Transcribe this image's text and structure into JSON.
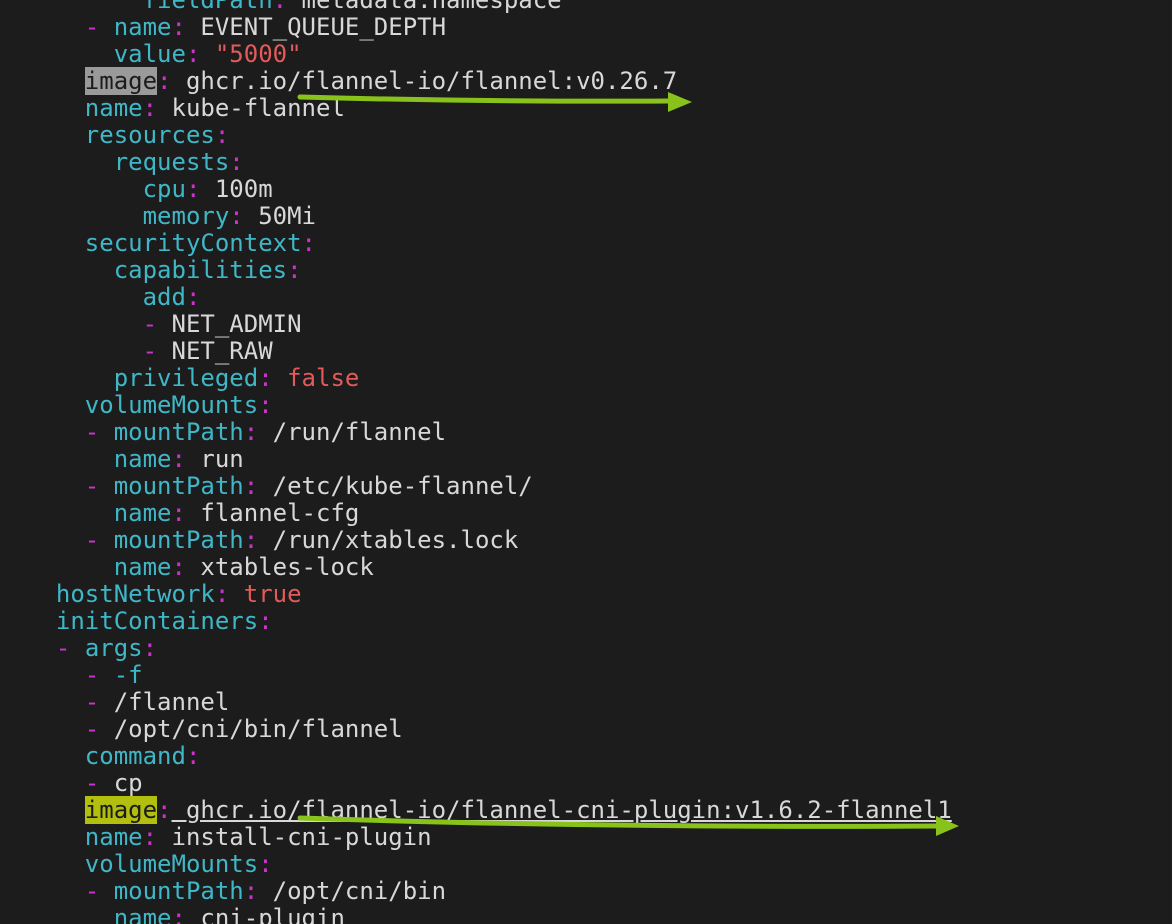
{
  "editor": {
    "lines": [
      {
        "indent": "        ",
        "dash": "",
        "key": "fieldPath",
        "colon": ":",
        "value": " metadata.namespace",
        "vclass": "v"
      },
      {
        "indent": "    ",
        "dash": "- ",
        "key": "name",
        "colon": ":",
        "value": " EVENT_QUEUE_DEPTH",
        "vclass": "v"
      },
      {
        "indent": "      ",
        "dash": "",
        "key": "value",
        "colon": ":",
        "value": " \"5000\"",
        "vclass": "q"
      },
      {
        "indent": "    ",
        "dash": "",
        "key": "image",
        "colon": ":",
        "value": " ghcr.io/flannel-io/flannel:v0.26.7",
        "vclass": "v",
        "highlight": "cursor"
      },
      {
        "indent": "    ",
        "dash": "",
        "key": "name",
        "colon": ":",
        "value": " kube-flannel",
        "vclass": "v"
      },
      {
        "indent": "    ",
        "dash": "",
        "key": "resources",
        "colon": ":",
        "value": "",
        "vclass": "v"
      },
      {
        "indent": "      ",
        "dash": "",
        "key": "requests",
        "colon": ":",
        "value": "",
        "vclass": "v"
      },
      {
        "indent": "        ",
        "dash": "",
        "key": "cpu",
        "colon": ":",
        "value": " 100m",
        "vclass": "v"
      },
      {
        "indent": "        ",
        "dash": "",
        "key": "memory",
        "colon": ":",
        "value": " 50Mi",
        "vclass": "v"
      },
      {
        "indent": "    ",
        "dash": "",
        "key": "securityContext",
        "colon": ":",
        "value": "",
        "vclass": "v"
      },
      {
        "indent": "      ",
        "dash": "",
        "key": "capabilities",
        "colon": ":",
        "value": "",
        "vclass": "v"
      },
      {
        "indent": "        ",
        "dash": "",
        "key": "add",
        "colon": ":",
        "value": "",
        "vclass": "v"
      },
      {
        "indent": "        ",
        "dash": "- ",
        "key": "",
        "colon": "",
        "value": "NET_ADMIN",
        "vclass": "v"
      },
      {
        "indent": "        ",
        "dash": "- ",
        "key": "",
        "colon": "",
        "value": "NET_RAW",
        "vclass": "v"
      },
      {
        "indent": "      ",
        "dash": "",
        "key": "privileged",
        "colon": ":",
        "value": " false",
        "vclass": "b"
      },
      {
        "indent": "    ",
        "dash": "",
        "key": "volumeMounts",
        "colon": ":",
        "value": "",
        "vclass": "v"
      },
      {
        "indent": "    ",
        "dash": "- ",
        "key": "mountPath",
        "colon": ":",
        "value": " /run/flannel",
        "vclass": "v"
      },
      {
        "indent": "      ",
        "dash": "",
        "key": "name",
        "colon": ":",
        "value": " run",
        "vclass": "v"
      },
      {
        "indent": "    ",
        "dash": "- ",
        "key": "mountPath",
        "colon": ":",
        "value": " /etc/kube-flannel/",
        "vclass": "v"
      },
      {
        "indent": "      ",
        "dash": "",
        "key": "name",
        "colon": ":",
        "value": " flannel-cfg",
        "vclass": "v"
      },
      {
        "indent": "    ",
        "dash": "- ",
        "key": "mountPath",
        "colon": ":",
        "value": " /run/xtables.lock",
        "vclass": "v"
      },
      {
        "indent": "      ",
        "dash": "",
        "key": "name",
        "colon": ":",
        "value": " xtables-lock",
        "vclass": "v"
      },
      {
        "indent": "  ",
        "dash": "",
        "key": "hostNetwork",
        "colon": ":",
        "value": " true",
        "vclass": "b"
      },
      {
        "indent": "  ",
        "dash": "",
        "key": "initContainers",
        "colon": ":",
        "value": "",
        "vclass": "v"
      },
      {
        "indent": "  ",
        "dash": "- ",
        "key": "args",
        "colon": ":",
        "value": "",
        "vclass": "v"
      },
      {
        "indent": "    ",
        "dash": "- ",
        "key": "",
        "colon": "",
        "value": "-f",
        "vclass": "k"
      },
      {
        "indent": "    ",
        "dash": "- ",
        "key": "",
        "colon": "",
        "value": "/flannel",
        "vclass": "v"
      },
      {
        "indent": "    ",
        "dash": "- ",
        "key": "",
        "colon": "",
        "value": "/opt/cni/bin/flannel",
        "vclass": "v"
      },
      {
        "indent": "    ",
        "dash": "",
        "key": "command",
        "colon": ":",
        "value": "",
        "vclass": "v"
      },
      {
        "indent": "    ",
        "dash": "- ",
        "key": "",
        "colon": "",
        "value": "cp",
        "vclass": "v"
      },
      {
        "indent": "    ",
        "dash": "",
        "key": "image",
        "colon": ":",
        "value": " ghcr.io/flannel-io/flannel-cni-plugin:v1.6.2-flannel1",
        "vclass": "v",
        "highlight": "match",
        "underline": true
      },
      {
        "indent": "    ",
        "dash": "",
        "key": "name",
        "colon": ":",
        "value": " install-cni-plugin",
        "vclass": "v"
      },
      {
        "indent": "    ",
        "dash": "",
        "key": "volumeMounts",
        "colon": ":",
        "value": "",
        "vclass": "v"
      },
      {
        "indent": "    ",
        "dash": "- ",
        "key": "mountPath",
        "colon": ":",
        "value": " /opt/cni/bin",
        "vclass": "v"
      },
      {
        "indent": "      ",
        "dash": "",
        "key": "name",
        "colon": ":",
        "value": " cni-plugin",
        "vclass": "v"
      }
    ]
  },
  "annotations": {
    "arrow_color": "#88c21a"
  }
}
